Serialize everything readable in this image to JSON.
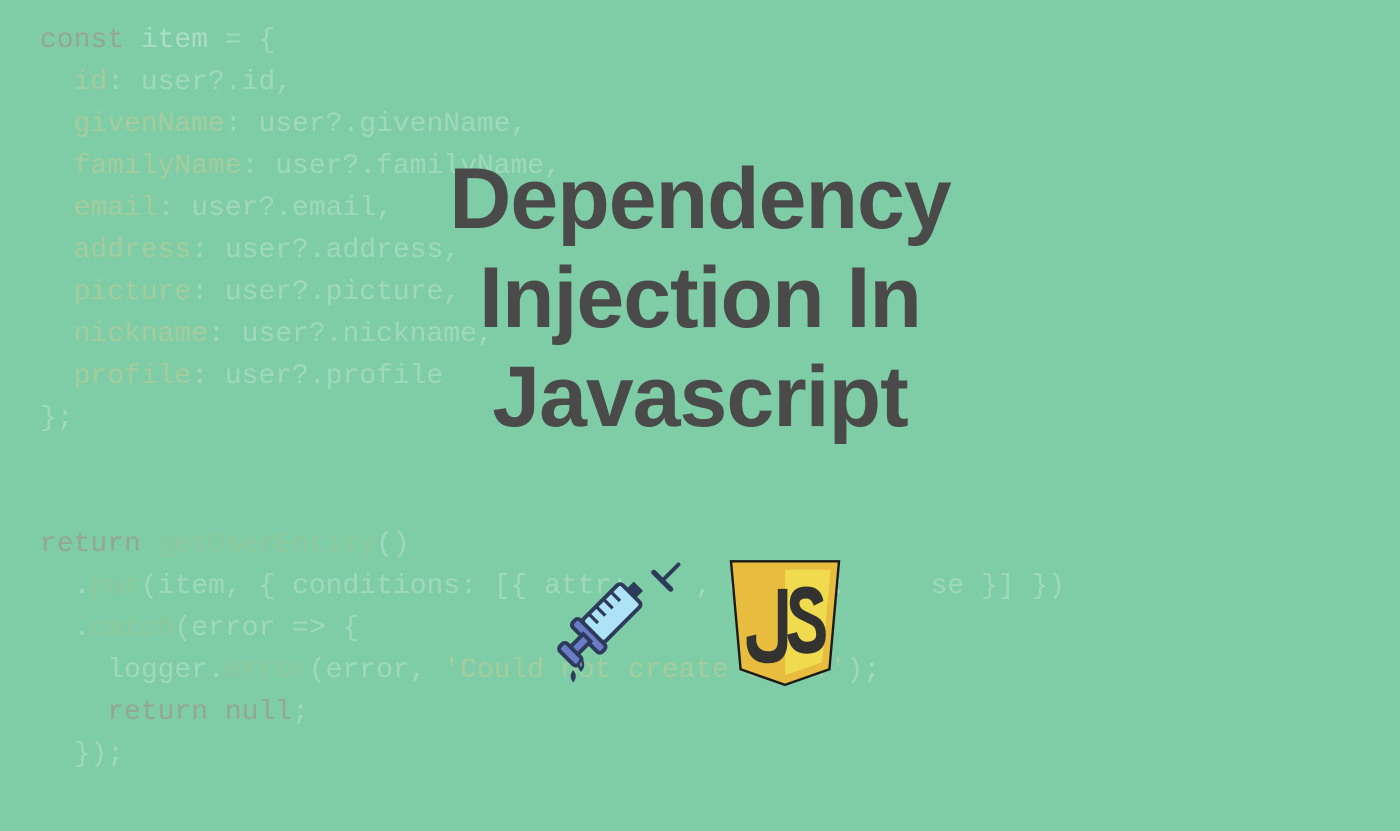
{
  "title": {
    "line1": "Dependency",
    "line2": "Injection In",
    "line3": "Javascript"
  },
  "background_code": {
    "lines": [
      "const item = {",
      "  id: user?.id,",
      "  givenName: user?.givenName,",
      "  familyName: user?.familyName,",
      "  email: user?.email,",
      "  address: user?.address,",
      "  picture: user?.picture,",
      "  nickname: user?.nickname,",
      "  profile: user?.profile",
      "};",
      "",
      "",
      "return getUserEntity()",
      "  .put(item, { conditions: [{ attr:   , exists:    se }] })",
      "  .catch(error => {",
      "    logger.error(error, 'Could not create user.');",
      "    return null;",
      "  });"
    ]
  },
  "icons": {
    "syringe": "syringe-icon",
    "js_badge": "js-logo-icon",
    "js_text": "JS"
  },
  "colors": {
    "background": "#7fcda6",
    "title": "#4a4a4a",
    "js_yellow": "#f0db4f",
    "js_dark": "#323330"
  }
}
